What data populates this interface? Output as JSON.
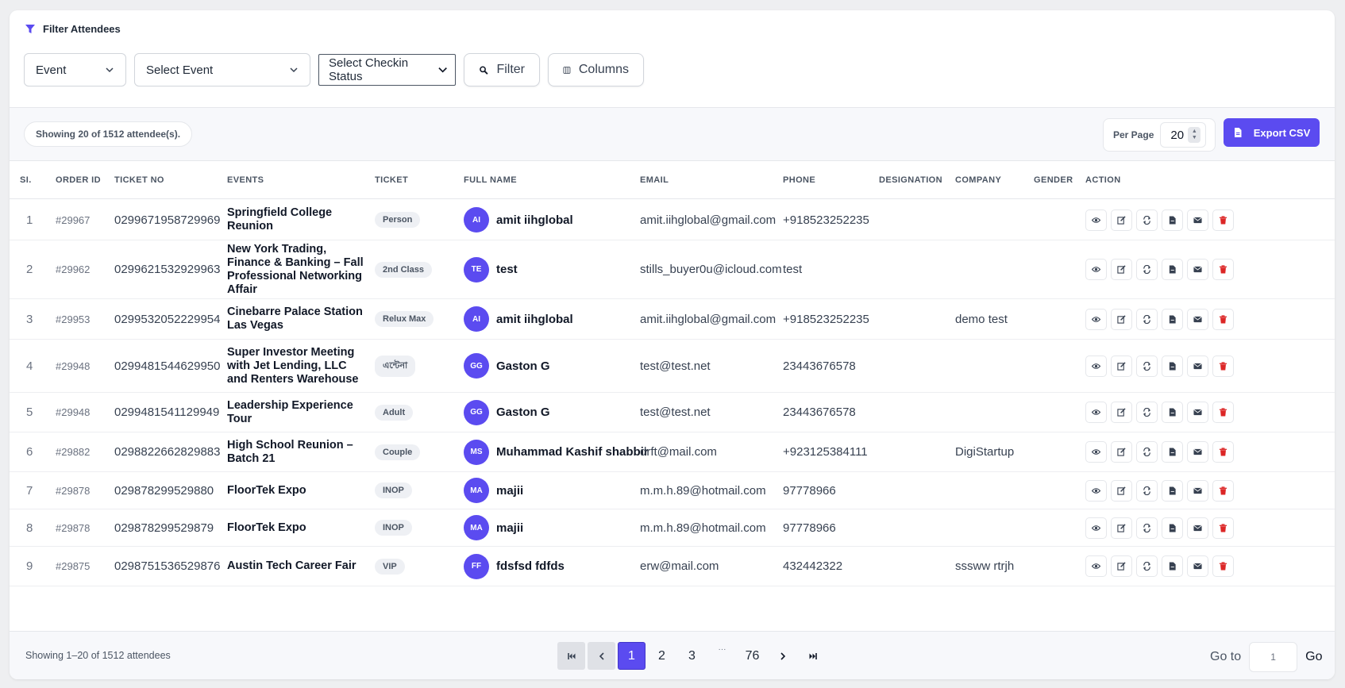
{
  "header": {
    "title": "Filter Attendees"
  },
  "filters": {
    "type_select": "Event",
    "event_select": "Select Event",
    "checkin_select": "Select Checkin Status",
    "filter_button": "Filter",
    "columns_button": "Columns"
  },
  "toolbar": {
    "showing": "Showing 20 of 1512 attendee(s).",
    "per_page_label": "Per Page",
    "per_page_value": "20",
    "export_label": "Export CSV"
  },
  "columns": [
    "SI.",
    "ORDER ID",
    "TICKET NO",
    "EVENTS",
    "TICKET",
    "FULL NAME",
    "EMAIL",
    "PHONE",
    "DESIGNATION",
    "COMPANY",
    "GENDER",
    "ACTION"
  ],
  "rows": [
    {
      "sl": "1",
      "order": "#29967",
      "ticket_no": "0299671958729969",
      "event": "Springfield College Reunion",
      "ticket": "Person",
      "initials": "AI",
      "name": "amit iihglobal",
      "email": "amit.iihglobal@gmail.com",
      "phone": "+918523252235",
      "designation": "",
      "company": "",
      "gender": ""
    },
    {
      "sl": "2",
      "order": "#29962",
      "ticket_no": "0299621532929963",
      "event": "New York Trading, Finance & Banking – Fall Professional Networking Affair",
      "ticket": "2nd Class",
      "initials": "TE",
      "name": "test",
      "email": "stills_buyer0u@icloud.com",
      "phone": "test",
      "designation": "",
      "company": "",
      "gender": ""
    },
    {
      "sl": "3",
      "order": "#29953",
      "ticket_no": "0299532052229954",
      "event": "Cinebarre Palace Station Las Vegas",
      "ticket": "Relux Max",
      "initials": "AI",
      "name": "amit iihglobal",
      "email": "amit.iihglobal@gmail.com",
      "phone": "+918523252235",
      "designation": "",
      "company": "demo test",
      "gender": ""
    },
    {
      "sl": "4",
      "order": "#29948",
      "ticket_no": "0299481544629950",
      "event": "Super Investor Meeting with Jet Lending, LLC and Renters Warehouse",
      "ticket": "এন্টেনা",
      "initials": "GG",
      "name": "Gaston G",
      "email": "test@test.net",
      "phone": "23443676578",
      "designation": "",
      "company": "",
      "gender": ""
    },
    {
      "sl": "5",
      "order": "#29948",
      "ticket_no": "0299481541129949",
      "event": "Leadership Experience Tour",
      "ticket": "Adult",
      "initials": "GG",
      "name": "Gaston G",
      "email": "test@test.net",
      "phone": "23443676578",
      "designation": "",
      "company": "",
      "gender": ""
    },
    {
      "sl": "6",
      "order": "#29882",
      "ticket_no": "0298822662829883",
      "event": "High School Reunion – Batch 21",
      "ticket": "Couple",
      "initials": "MS",
      "name": "Muhammad Kashif shabbir",
      "email": "drft@mail.com",
      "phone": "+923125384111",
      "designation": "",
      "company": "DigiStartup",
      "gender": ""
    },
    {
      "sl": "7",
      "order": "#29878",
      "ticket_no": "029878299529880",
      "event": "FloorTek Expo",
      "ticket": "INOP",
      "initials": "MA",
      "name": "majii",
      "email": "m.m.h.89@hotmail.com",
      "phone": "97778966",
      "designation": "",
      "company": "",
      "gender": ""
    },
    {
      "sl": "8",
      "order": "#29878",
      "ticket_no": "029878299529879",
      "event": "FloorTek Expo",
      "ticket": "INOP",
      "initials": "MA",
      "name": "majii",
      "email": "m.m.h.89@hotmail.com",
      "phone": "97778966",
      "designation": "",
      "company": "",
      "gender": ""
    },
    {
      "sl": "9",
      "order": "#29875",
      "ticket_no": "0298751536529876",
      "event": "Austin Tech Career Fair",
      "ticket": "VIP",
      "initials": "FF",
      "name": "fdsfsd fdfds",
      "email": "erw@mail.com",
      "phone": "432442322",
      "designation": "",
      "company": "sssww rtrjh",
      "gender": ""
    }
  ],
  "action_icons": [
    "eye-icon",
    "edit-icon",
    "refresh-icon",
    "pdf-icon",
    "mail-icon",
    "trash-icon"
  ],
  "footer": {
    "showing": "Showing 1–20 of 1512 attendees",
    "pages": [
      "1",
      "2",
      "3",
      "76"
    ],
    "ellipsis": "···",
    "current_page": "1",
    "goto_label": "Go to",
    "goto_value": "1",
    "go_label": "Go"
  },
  "colors": {
    "accent": "#5b4bf0",
    "danger": "#dc2626"
  }
}
